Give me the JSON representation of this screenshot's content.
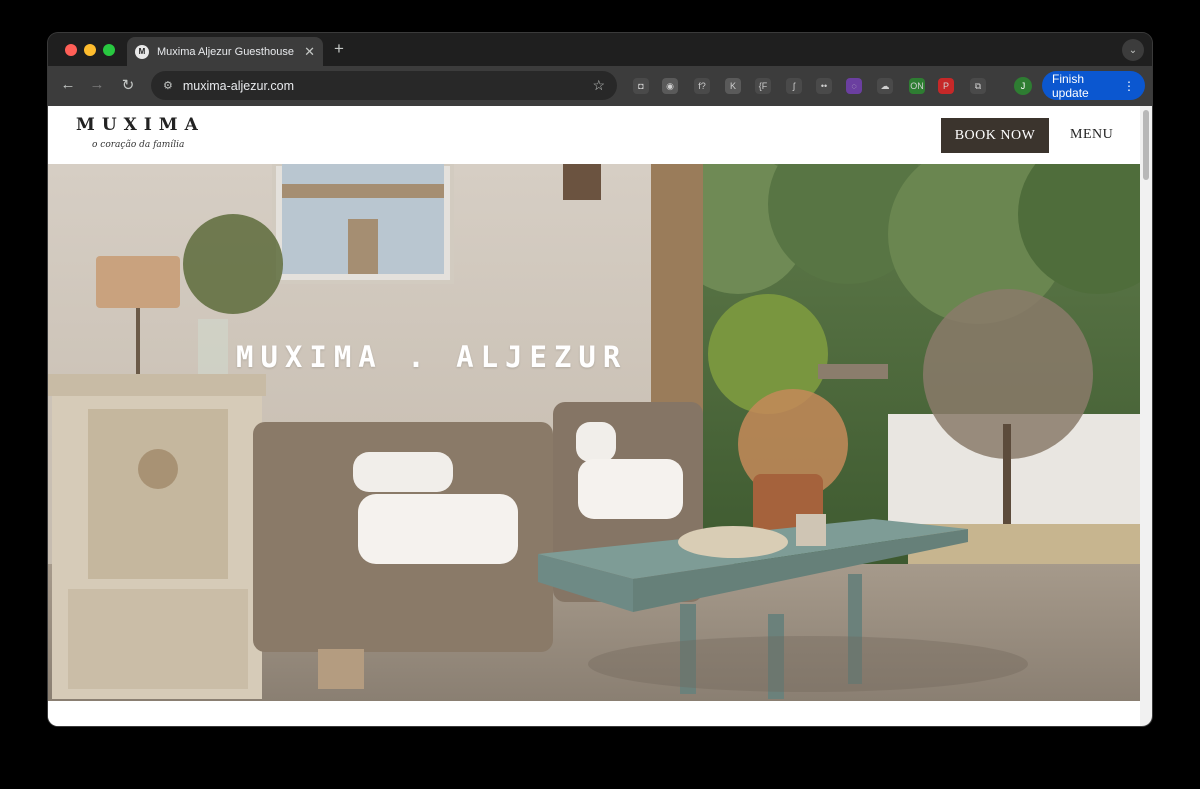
{
  "browser": {
    "tab_title": "Muxima Aljezur Guesthouse",
    "tab_favicon": "M",
    "tab_close": "✕",
    "new_tab": "+",
    "tab_menu": "⌄",
    "url": "muxima-aljezur.com",
    "finish_update_label": "Finish update",
    "finish_update_menu": "⋮",
    "profile_initial": "J",
    "nav": {
      "back": "←",
      "forward": "→",
      "reload": "↻",
      "star": "☆",
      "site_info": "⚙"
    },
    "extensions": [
      {
        "name": "camera-icon",
        "glyph": "◘"
      },
      {
        "name": "circle-ext-icon",
        "glyph": "◉"
      },
      {
        "name": "font-ext-icon",
        "glyph": "f?"
      },
      {
        "name": "k-ext-icon",
        "glyph": "K"
      },
      {
        "name": "bracket-f-ext-icon",
        "glyph": "{F"
      },
      {
        "name": "feather-ext-icon",
        "glyph": "ʃ"
      },
      {
        "name": "eyes-ext-icon",
        "glyph": "••"
      },
      {
        "name": "purple-ext-icon",
        "glyph": "◌"
      },
      {
        "name": "cloud-ext-icon",
        "glyph": "☁"
      },
      {
        "name": "on-ext-icon",
        "glyph": "ON"
      },
      {
        "name": "pinterest-icon",
        "glyph": "P"
      },
      {
        "name": "puzzle-icon",
        "glyph": "⧉"
      }
    ]
  },
  "site": {
    "logo_word": "MUXIMA",
    "logo_tagline": "o coração da família",
    "book_now_label": "BOOK NOW",
    "menu_label": "MENU",
    "hero_title": "MUXIMA . ALJEZUR"
  },
  "colors": {
    "book_button": "#3b342d",
    "finish_update": "#0b57d0",
    "browser_chrome": "#3c3c3c"
  }
}
